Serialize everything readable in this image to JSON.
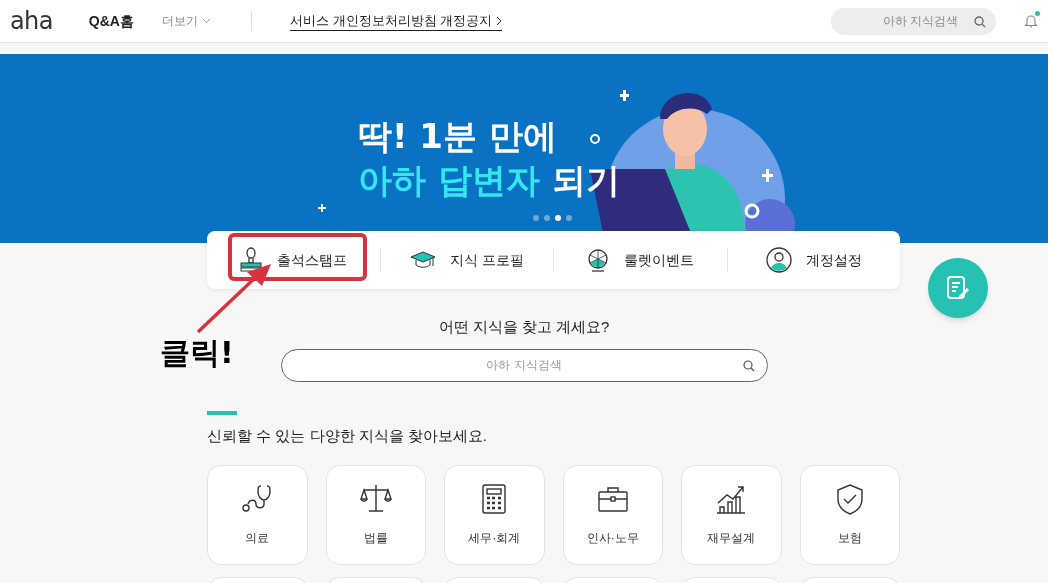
{
  "header": {
    "logo": "aha",
    "nav": [
      {
        "label": "Q&A홈",
        "selected": true
      },
      {
        "label": "더보기",
        "selected": false,
        "kind": "dropdown"
      }
    ],
    "notice": "서비스 개인정보처리방침 개정공지",
    "search": {
      "placeholder": "아하 지식검색"
    },
    "notification_unread": true
  },
  "banner": {
    "line_1": "딱! 1분 만에",
    "line_2_highlight": "아하 답변자",
    "line_2_rest": "되기",
    "dots": [
      {
        "selected": false
      },
      {
        "selected": false
      },
      {
        "selected": true
      },
      {
        "selected": false
      }
    ]
  },
  "quick_menu": [
    {
      "label": "출석스탬프",
      "kind": "stamp"
    },
    {
      "label": "지식 프로필",
      "kind": "cap"
    },
    {
      "label": "룰렛이벤트",
      "kind": "roulette"
    },
    {
      "label": "계정설정",
      "kind": "account"
    }
  ],
  "annotation": {
    "text": "클릭!"
  },
  "search": {
    "title": "어떤 지식을 찾고 계세요?",
    "placeholder": "아하 지식검색"
  },
  "categories": {
    "title": "신뢰할 수 있는 다양한 지식을 찾아보세요.",
    "items": [
      {
        "label": "의료",
        "kind": "medical"
      },
      {
        "label": "법률",
        "kind": "law"
      },
      {
        "label": "세무·회계",
        "kind": "tax"
      },
      {
        "label": "인사·노무",
        "kind": "hr"
      },
      {
        "label": "재무설계",
        "kind": "finance"
      },
      {
        "label": "보험",
        "kind": "insurance"
      }
    ]
  }
}
